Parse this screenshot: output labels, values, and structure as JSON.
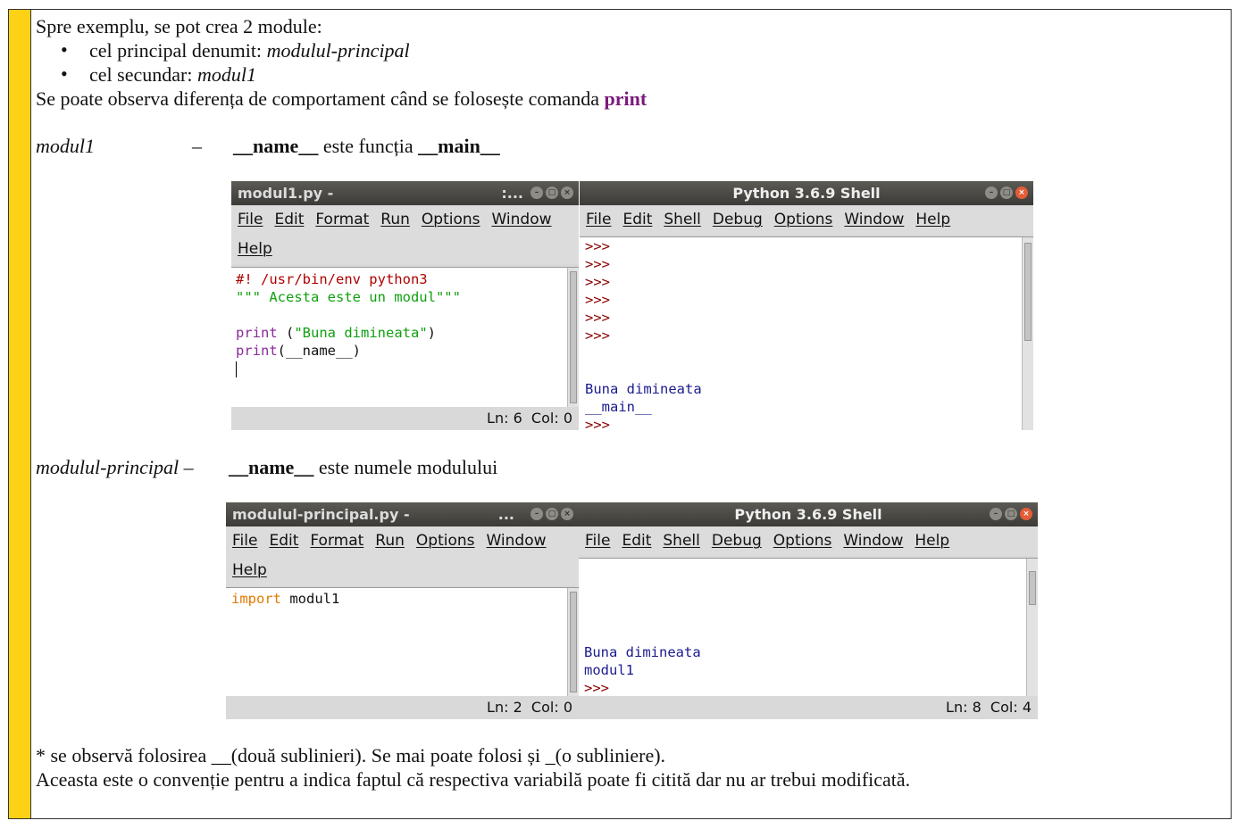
{
  "intro": {
    "line1": "Spre exemplu, se pot crea 2 module:",
    "bullet1_prefix": "cel principal denumit: ",
    "bullet1_name": "modulul-principal",
    "bullet2_prefix": "cel secundar: ",
    "bullet2_name": "modul1",
    "line4_prefix": "Se poate observa diferența de comportament când se folosește comanda ",
    "line4_keyword": "print"
  },
  "section1": {
    "label": "modul1",
    "dash": "–",
    "name_var": "__name__",
    "middle": " este funcția ",
    "main_var": "__main__"
  },
  "section2": {
    "label": "modulul-principal –",
    "name_var": "__name__",
    "rest": " este numele modulului"
  },
  "editor1": {
    "title": "modul1.py - ",
    "title_tail": ":...",
    "menu_row1": [
      "File",
      "Edit",
      "Format",
      "Run",
      "Options",
      "Window"
    ],
    "menu_row2": [
      "Help"
    ],
    "code": {
      "shebang": "#! /usr/bin/env python3",
      "docstring": "\"\"\" Acesta este un modul\"\"\"",
      "line4_kw": "print",
      "line4_rest_open": " (",
      "line4_str": "\"Buna dimineata\"",
      "line4_close": ")",
      "line5_kw": "print",
      "line5_rest": "(__name__)"
    },
    "status": "Ln: 6  Col: 0"
  },
  "shell1": {
    "title": "Python 3.6.9 Shell",
    "menu": [
      "File",
      "Edit",
      "Shell",
      "Debug",
      "Options",
      "Window",
      "Help"
    ],
    "prompt": ">>>",
    "output1": "Buna dimineata",
    "output2": "__main__"
  },
  "editor2": {
    "title": "modulul-principal.py - ",
    "title_tail": "...",
    "menu_row1": [
      "File",
      "Edit",
      "Format",
      "Run",
      "Options",
      "Window"
    ],
    "menu_row2": [
      "Help"
    ],
    "code": {
      "kw": "import",
      "rest": " modul1"
    },
    "status": "Ln: 2  Col: 0"
  },
  "shell2": {
    "title": "Python 3.6.9 Shell",
    "menu": [
      "File",
      "Edit",
      "Shell",
      "Debug",
      "Options",
      "Window",
      "Help"
    ],
    "output1": "Buna dimineata",
    "output2": "modul1",
    "prompt": ">>>",
    "status": "Ln: 8  Col: 4"
  },
  "footer": {
    "line1": "* se observă folosirea __(două sublinieri). Se mai poate folosi și _(o subliniere).",
    "line2": "Aceasta este o convenție pentru a indica faptul că respectiva variabilă poate fi citită dar nu ar trebui modificată."
  }
}
